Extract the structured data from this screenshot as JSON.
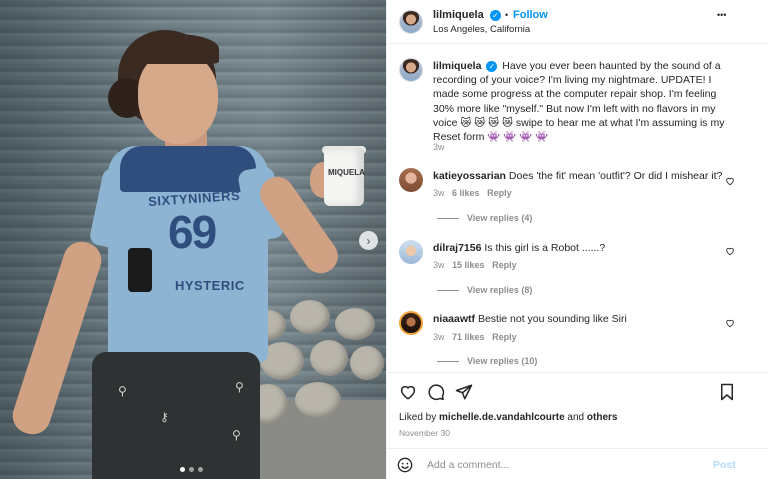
{
  "post": {
    "username": "lilmiquela",
    "follow_label": "Follow",
    "separator": "•",
    "location": "Los Angeles, California",
    "more_label": "•••",
    "caption_lines": [
      "Have you ever been haunted by the sound of a",
      "recording of your voice? I'm living my nightmare. UPDATE! I",
      "made some progress at the computer repair shop. I'm feeling",
      "30% more like \"myself.\" But now I'm left with no flavors in my",
      "voice 😿 😿 😿 😿 swipe to hear me at what I'm assuming is my",
      "Reset form 👾 👾 👾 👾"
    ],
    "caption_time": "3w"
  },
  "photo": {
    "shirt_top": "SIXTYNINERS",
    "shirt_number": "69",
    "shirt_bottom": "HYSTERIC",
    "cup_label": "MIQUELA",
    "next_label": "›",
    "slides_total": 3,
    "slide_active": 1
  },
  "comments": [
    {
      "username": "katieyossarian",
      "text": "Does 'the fit' mean 'outfit'? Or did I mishear it?",
      "time": "3w",
      "likes": "6 likes",
      "reply": "Reply",
      "view_replies": "View replies (4)"
    },
    {
      "username": "dilraj7156",
      "text": "Is this girl is a Robot ......?",
      "time": "3w",
      "likes": "15 likes",
      "reply": "Reply",
      "view_replies": "View replies (8)"
    },
    {
      "username": "niaaawtf",
      "text": "Bestie not you sounding like Siri",
      "time": "3w",
      "likes": "71 likes",
      "reply": "Reply",
      "view_replies": "View replies (10)"
    }
  ],
  "engagement": {
    "liked_by_prefix": "Liked by",
    "liked_by_user": "michelle.de.vandahlcourte",
    "liked_by_and": "and",
    "liked_by_others": "others",
    "date": "November 30"
  },
  "add_comment": {
    "placeholder": "Add a comment...",
    "post_label": "Post"
  },
  "colors": {
    "accent": "#0095f6",
    "post_disabled": "#b3dbff",
    "muted": "#8e8e8e"
  }
}
